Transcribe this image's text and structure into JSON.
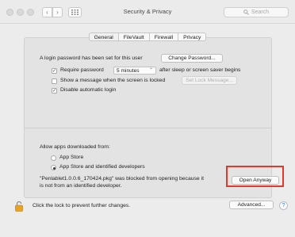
{
  "window": {
    "title": "Security & Privacy",
    "search_placeholder": "Search",
    "nav": {
      "back": "‹",
      "forward": "›"
    }
  },
  "tabs": [
    {
      "label": "General",
      "active": true
    },
    {
      "label": "FileVault",
      "active": false
    },
    {
      "label": "Firewall",
      "active": false
    },
    {
      "label": "Privacy",
      "active": false
    }
  ],
  "general": {
    "password_text": "A login password has been set for this user",
    "change_password_button": "Change Password...",
    "require_password": {
      "label": "Require password",
      "checked": true,
      "select_value": "5 minutes",
      "suffix": "after sleep or screen saver begins"
    },
    "show_message": {
      "label": "Show a message when the screen is locked",
      "checked": false,
      "button": "Set Lock Message..."
    },
    "disable_autologin": {
      "label": "Disable automatic login",
      "checked": true
    }
  },
  "downloads": {
    "heading": "Allow apps downloaded from:",
    "options": [
      {
        "label": "App Store",
        "selected": false
      },
      {
        "label": "App Store and identified developers",
        "selected": true
      }
    ],
    "blocked_line1": "\"Penlablet1.0.0.6_170424.pkg\" was blocked from opening because it",
    "blocked_line2": "is not from an identified developer.",
    "open_anyway_button": "Open Anyway",
    "highlight_color": "#e3382c"
  },
  "footer": {
    "lock_text": "Click the lock to prevent further changes.",
    "advanced_button": "Advanced...",
    "help": "?"
  }
}
